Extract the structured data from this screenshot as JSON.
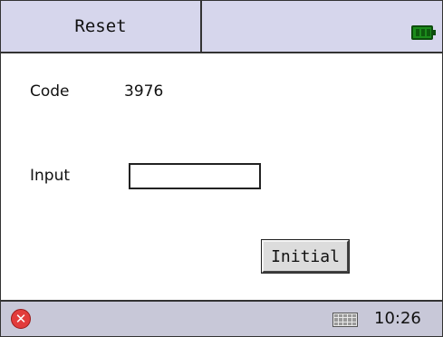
{
  "header": {
    "title": "Reset",
    "battery_icon": "battery-full-icon"
  },
  "form": {
    "code_label": "Code",
    "code_value": "3976",
    "input_label": "Input",
    "input_value": "",
    "initial_button_label": "Initial"
  },
  "taskbar": {
    "close_icon": "close-icon",
    "keyboard_icon": "keyboard-icon",
    "time": "10:26"
  },
  "colors": {
    "bar_background": "#d6d6ec",
    "battery": "#1c8c1c",
    "close": "#e23c3c"
  }
}
